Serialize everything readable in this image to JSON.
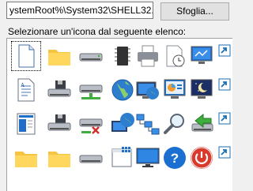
{
  "path_field": {
    "value": "ystemRoot%\\System32\\SHELL32.dll"
  },
  "browse_button": {
    "label": "Sfoglia..."
  },
  "list_label": "Selezionare un'icona dal seguente elenco:",
  "icons": [
    [
      "blank-document-icon",
      "folder-icon",
      "drive-icon",
      "memory-chip-icon",
      "printer-icon",
      "document-clock-icon",
      "monitor-network-icon",
      "shortcut-arrow-icon"
    ],
    [
      "text-document-icon",
      "floppy-drive-icon",
      "network-drive-icon",
      "globe-icon",
      "computer-globe-icon",
      "control-panel-icon",
      "screensaver-icon",
      "shortcut-arrow-icon"
    ],
    [
      "window-document-icon",
      "floppy-drive-2-icon",
      "disconnected-drive-icon",
      "network-globe-icon",
      "network-tree-icon",
      "magnifier-icon",
      "remove-drive-icon",
      "shortcut-arrow-icon"
    ],
    [
      "folder-open-icon",
      "folder-2-icon",
      "drive-2-icon",
      "grid-window-icon",
      "monitor-icon",
      "help-icon",
      "power-icon",
      "shortcut-arrow-icon"
    ]
  ]
}
